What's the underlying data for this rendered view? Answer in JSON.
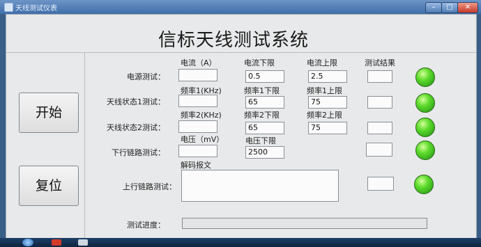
{
  "window": {
    "title": "天线测试仪表"
  },
  "header": {
    "title": "信标天线测试系统"
  },
  "controls": {
    "start_label": "开始",
    "reset_label": "复位"
  },
  "columns": {
    "current": "电流（A）",
    "current_low": "电流下限",
    "current_high": "电流上限",
    "result": "测试结果"
  },
  "rows": {
    "power": {
      "label": "电源测试：",
      "value": "",
      "low": "0.5",
      "high": "2.5",
      "result": "",
      "status_color": "#3cc81e"
    },
    "antenna1": {
      "label": "天线状态1测试：",
      "col1": "频率1(KHz)",
      "col2": "频率1下限",
      "col3": "频率1上限",
      "value": "",
      "low": "65",
      "high": "75",
      "result": "",
      "status_color": "#3cc81e"
    },
    "antenna2": {
      "label": "天线状态2测试：",
      "col1": "频率2(KHz)",
      "col2": "频率2下限",
      "col3": "频率2上限",
      "value": "",
      "low": "65",
      "high": "75",
      "result": "",
      "status_color": "#3cc81e"
    },
    "downlink": {
      "label": "下行链路测试：",
      "col1": "电压（mV）",
      "col2": "电压下限",
      "value": "",
      "low": "2500",
      "result": "",
      "status_color": "#3cc81e"
    },
    "uplink": {
      "label": "上行链路测试：",
      "col1": "解码报文",
      "value": "",
      "result": "",
      "status_color": "#3cc81e"
    }
  },
  "progress": {
    "label": "测试进度：",
    "fraction": 0
  }
}
